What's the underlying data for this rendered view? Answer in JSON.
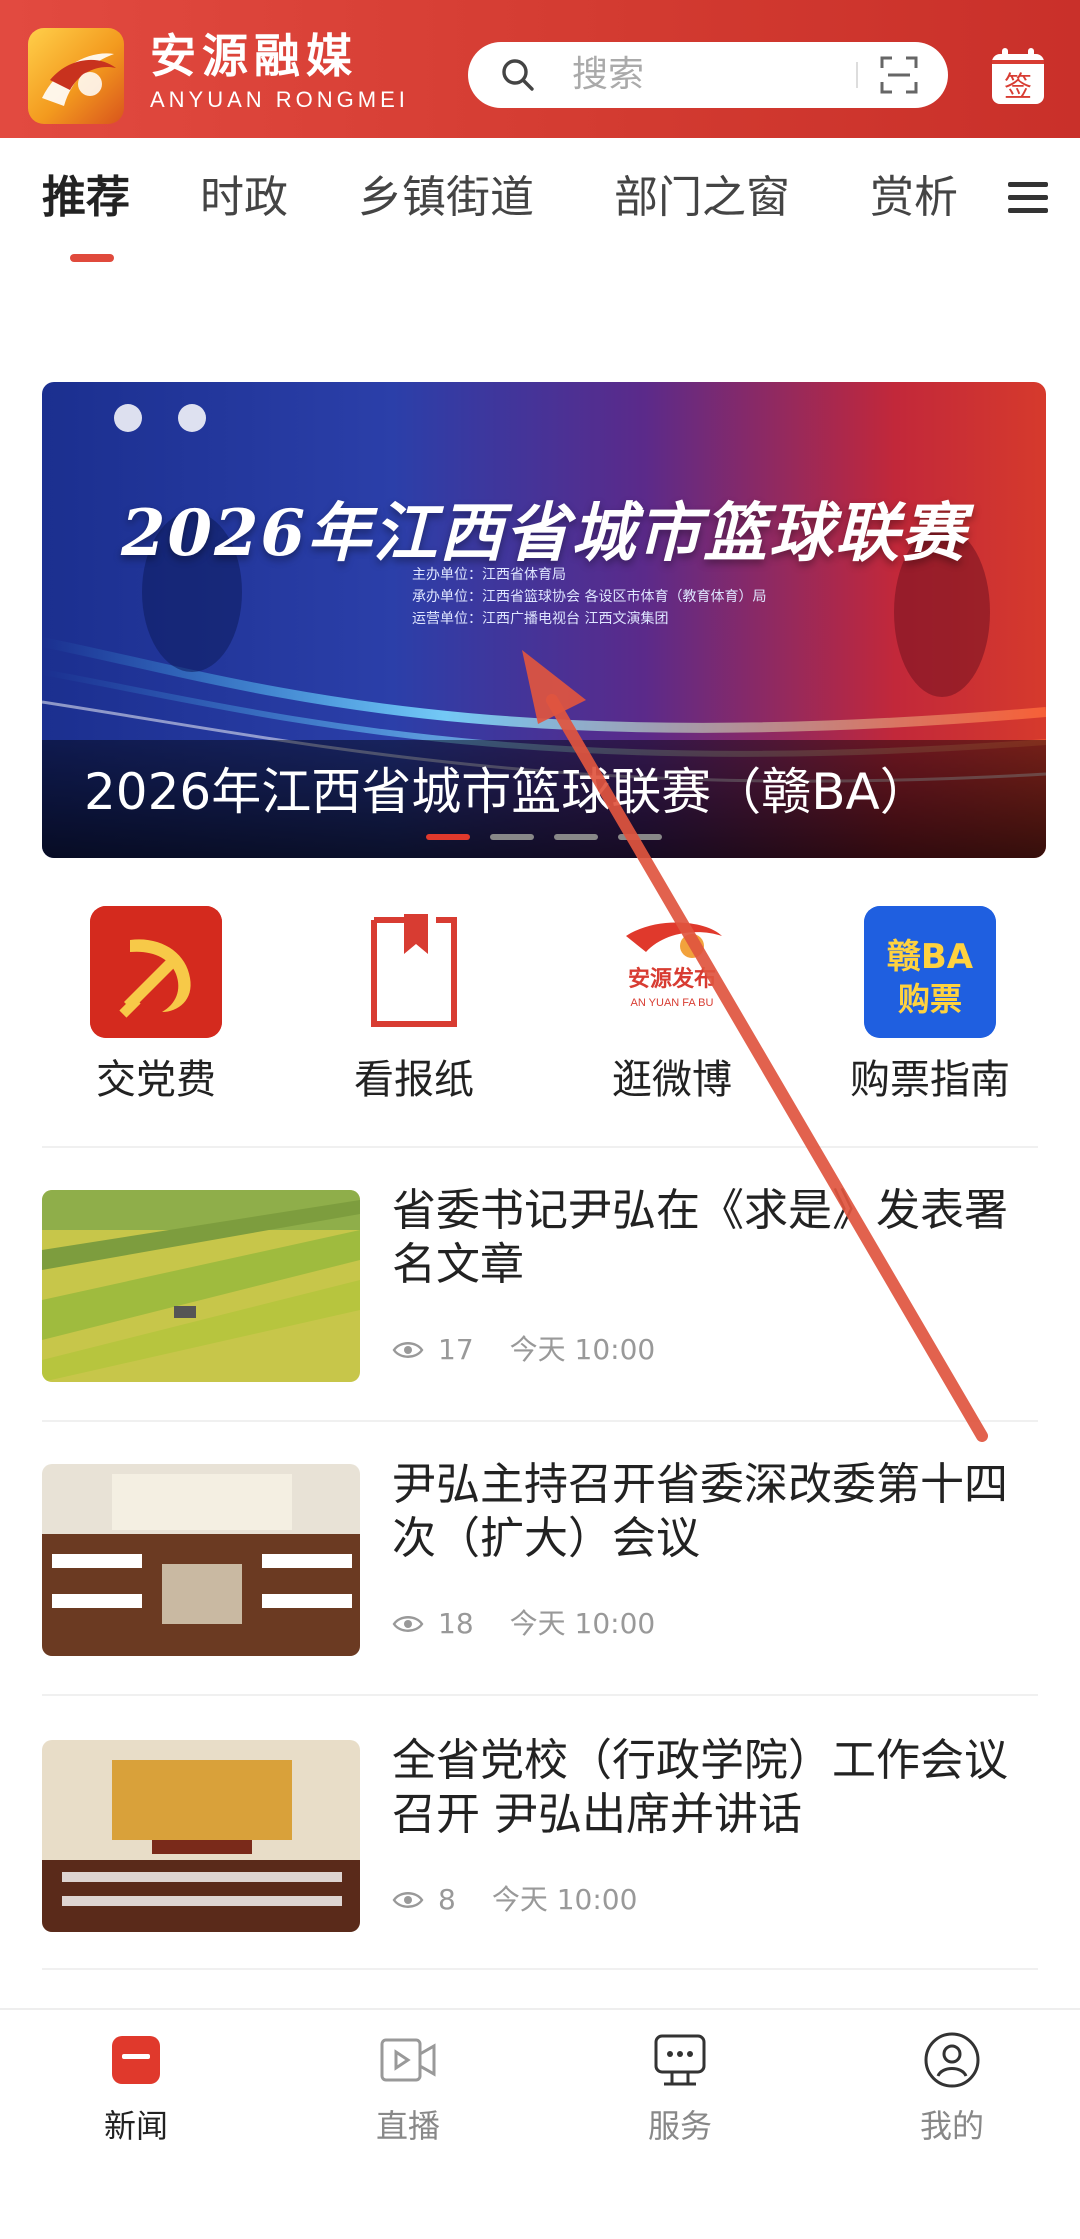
{
  "header": {
    "brand_cn": "安源融媒",
    "brand_en": "ANYUAN RONGMEI",
    "search_placeholder": "搜索",
    "sign_label": "签"
  },
  "tabs": [
    {
      "label": "推荐",
      "active": true
    },
    {
      "label": "时政"
    },
    {
      "label": "乡镇街道"
    },
    {
      "label": "部门之窗"
    },
    {
      "label": "赏析"
    }
  ],
  "banner": {
    "title": "2026年江西省城市篮球联赛",
    "lines": [
      "主办单位：江西省体育局",
      "承办单位：江西省篮球协会 各设区市体育（教育体育）局",
      "运营单位：江西广播电视台 江西文演集团"
    ],
    "caption": "2026年江西省城市篮球联赛（赣BA）",
    "slides": 4,
    "active_slide": 1
  },
  "quick_entries": [
    {
      "label": "交党费",
      "icon": "party-emblem-icon"
    },
    {
      "label": "看报纸",
      "icon": "bookmark-icon"
    },
    {
      "label": "逛微博",
      "icon": "anyuan-fabu-icon",
      "icon_text": "安源发布",
      "icon_text_en": "AN YUAN FA BU"
    },
    {
      "label": "购票指南",
      "icon": "ganba-ticket-icon",
      "icon_text_1": "赣BA",
      "icon_text_2": "购票"
    }
  ],
  "news": [
    {
      "title": "省委书记尹弘在《求是》发表署名文章",
      "views": "17",
      "time": "今天 10:00"
    },
    {
      "title": "尹弘主持召开省委深改委第十四次（扩大）会议",
      "views": "18",
      "time": "今天 10:00"
    },
    {
      "title": "全省党校（行政学院）工作会议召开 尹弘出席并讲话",
      "views": "8",
      "time": "今天 10:00"
    }
  ],
  "bottom_nav": [
    {
      "label": "新闻",
      "active": true
    },
    {
      "label": "直播"
    },
    {
      "label": "服务"
    },
    {
      "label": "我的"
    }
  ],
  "colors": {
    "brand_red": "#d83c32",
    "accent": "#e0392c",
    "annotation_arrow": "#e0553f"
  }
}
